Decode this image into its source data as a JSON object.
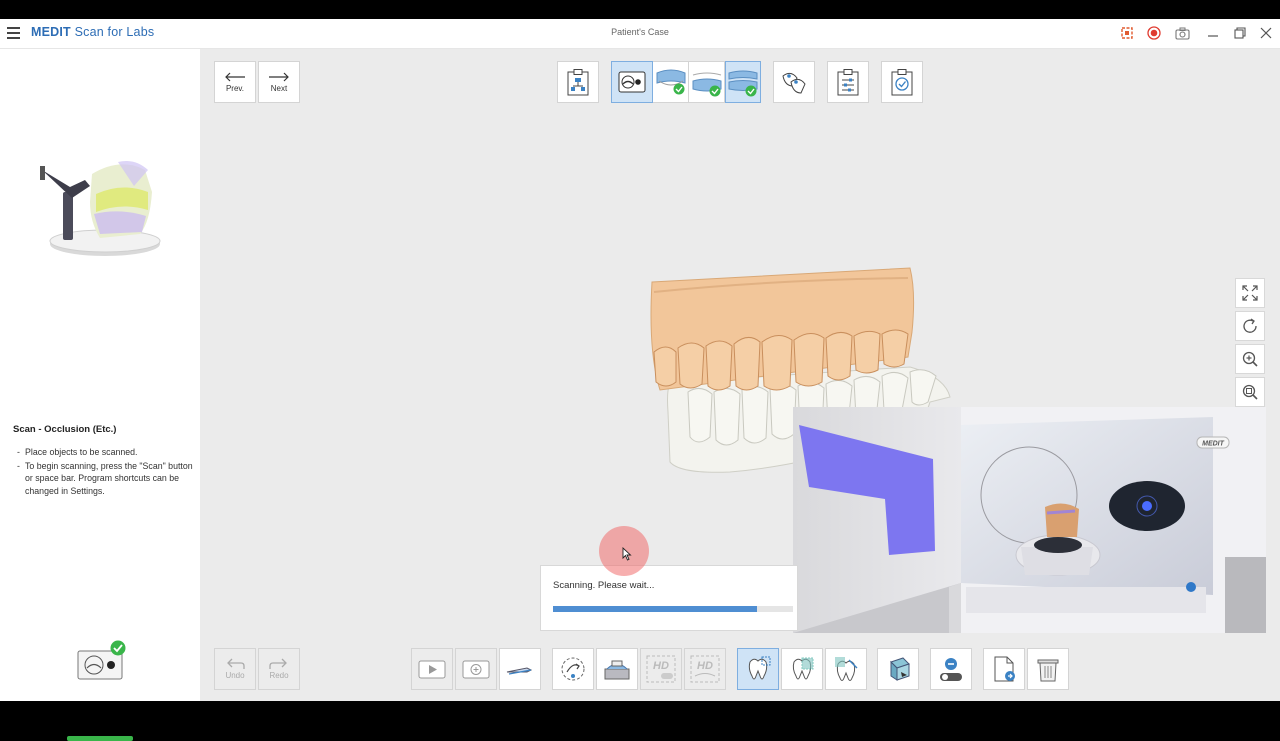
{
  "window": {
    "app_title_brand": "MEDIT",
    "app_title_rest": "Scan for Labs",
    "title": "Patient's Case"
  },
  "nav": {
    "prev_label": "Prev.",
    "next_label": "Next"
  },
  "workflow_steps": [
    {
      "icon": "form-icon",
      "active": false
    },
    {
      "icon": "scanner-icon",
      "active": true
    },
    {
      "icon": "maxilla-done-icon",
      "active": false
    },
    {
      "icon": "mandible-done-icon",
      "active": false
    },
    {
      "icon": "occlusion-done-icon",
      "active": true
    },
    {
      "icon": "alignment-icon",
      "active": false
    },
    {
      "icon": "settings-sliders-icon",
      "active": false
    },
    {
      "icon": "complete-check-icon",
      "active": false
    }
  ],
  "sidebar": {
    "scan_title": "Scan - Occlusion (Etc.)",
    "instructions": [
      "Place objects to be scanned.",
      "To begin scanning, press the \"Scan\" button or space bar. Program shortcuts can be changed in Settings."
    ],
    "progress_percent": 100
  },
  "progress": {
    "text": "Scanning. Please wait...",
    "percent": 85
  },
  "bottom_toolbar": {
    "undo_label": "Undo",
    "redo_label": "Redo"
  },
  "overlay": {
    "brand_label": "MEDIT"
  },
  "colors": {
    "accent": "#2d6db5",
    "progress": "#4f8ed2",
    "active_bg": "#cfe3f6",
    "tooth_upper": "#f2c69a",
    "success": "#39b54a",
    "record": "#e03a2f"
  }
}
